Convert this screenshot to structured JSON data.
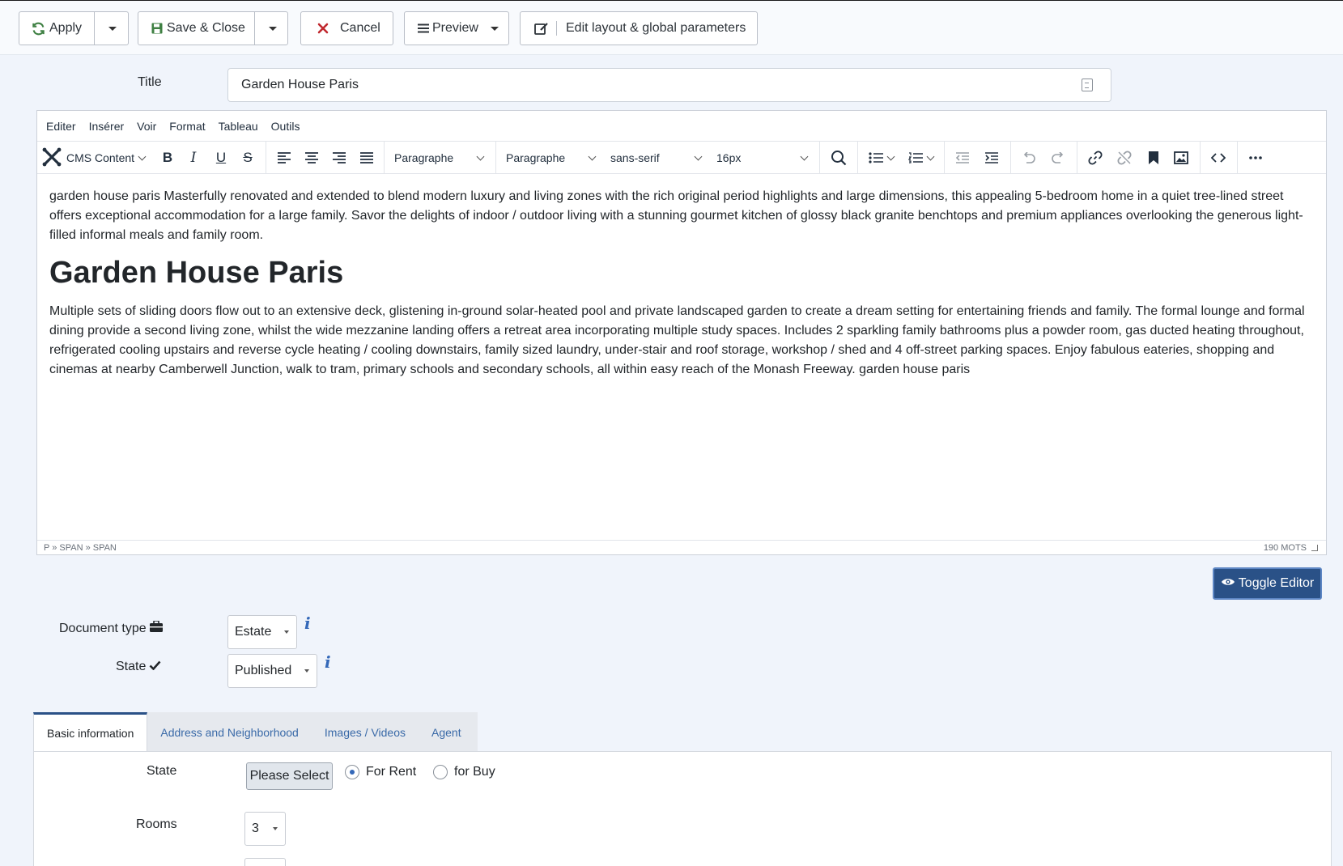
{
  "toolbar": {
    "apply_label": "Apply",
    "save_close_label": "Save & Close",
    "cancel_label": "Cancel",
    "preview_label": "Preview",
    "edit_layout_label": "Edit layout & global parameters"
  },
  "title_field": {
    "label": "Title",
    "value": "Garden House Paris"
  },
  "editor": {
    "menu": [
      "Editer",
      "Insérer",
      "Voir",
      "Format",
      "Tableau",
      "Outils"
    ],
    "cms_content_label": "CMS Content",
    "block_format_1": "Paragraphe",
    "block_format_2": "Paragraphe",
    "font_family": "sans-serif",
    "font_size": "16px",
    "paragraph_1": "garden house paris Masterfully renovated and extended to blend modern luxury and living zones with the rich original period highlights and large dimensions, this appealing 5-bedroom home in a quiet tree-lined street offers exceptional accommodation for a large family. Savor the delights of indoor / outdoor living with a stunning gourmet kitchen of glossy black granite benchtops and premium appliances overlooking the generous light-filled informal meals and family room.",
    "heading": "Garden House Paris",
    "paragraph_2": "Multiple sets of sliding doors flow out to an extensive deck, glistening in-ground solar-heated pool and private landscaped garden to create a dream setting for entertaining friends and family. The formal lounge and formal dining provide a second living zone, whilst the wide mezzanine landing offers a retreat area incorporating multiple study spaces. Includes 2 sparkling family bathrooms plus a powder room, gas ducted heating throughout, refrigerated cooling upstairs and reverse cycle heating / cooling downstairs, family sized laundry, under-stair and roof storage, workshop / shed and 4 off-street parking spaces. Enjoy fabulous eateries, shopping and cinemas at nearby Camberwell Junction, walk to tram, primary schools and secondary schools, all within easy reach of the Monash Freeway. garden house paris",
    "path": "P » SPAN » SPAN",
    "word_count": "190 MOTS"
  },
  "toggle_editor_label": "Toggle Editor",
  "document_type": {
    "label": "Document type",
    "value": "Estate"
  },
  "state_field": {
    "label": "State",
    "value": "Published"
  },
  "tabs": [
    "Basic information",
    "Address and Neighborhood",
    "Images / Videos",
    "Agent"
  ],
  "basic_info": {
    "state_label": "State",
    "please_select": "Please Select",
    "for_rent": "For Rent",
    "for_buy": "for Buy",
    "rooms_label": "Rooms",
    "rooms_value": "3"
  },
  "colors": {
    "primary": "#2a5187",
    "link": "#3468b8",
    "cancel_red": "#c0282e",
    "save_green": "#3f8043"
  }
}
